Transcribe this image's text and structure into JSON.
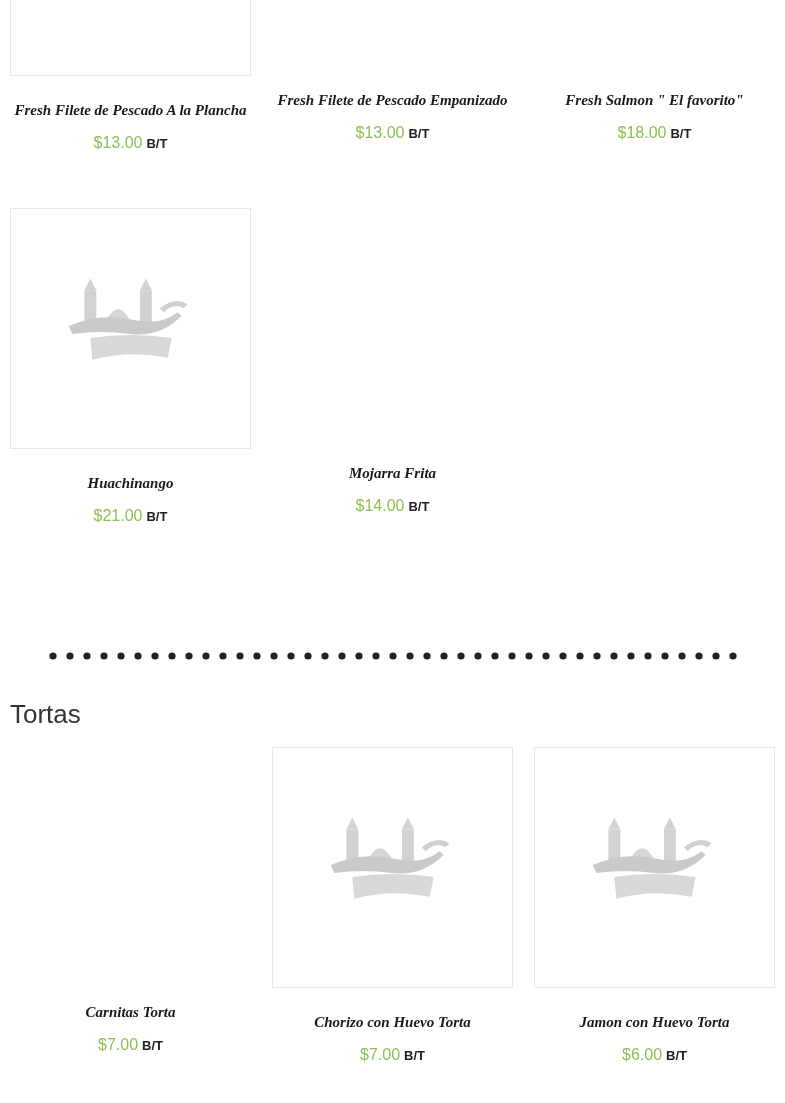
{
  "sections": [
    {
      "items": [
        {
          "name": "Fresh Filete de Pescado A la Plancha",
          "price": "$13.00",
          "unit": "B/T",
          "kind": "picture"
        },
        {
          "name": "Fresh Filete de Pescado Empanizado",
          "price": "$13.00",
          "unit": "B/T",
          "kind": "blank"
        },
        {
          "name": "Fresh Salmon \" El favorito\"",
          "price": "$18.00",
          "unit": "B/T",
          "kind": "blank"
        },
        {
          "name": "Huachinango",
          "price": "$21.00",
          "unit": "B/T",
          "kind": "picture"
        },
        {
          "name": "Mojarra Frita",
          "price": "$14.00",
          "unit": "B/T",
          "kind": "blank"
        }
      ]
    },
    {
      "heading": "Tortas",
      "items": [
        {
          "name": "Carnitas Torta",
          "price": "$7.00",
          "unit": "B/T",
          "kind": "blank"
        },
        {
          "name": "Chorizo con Huevo Torta",
          "price": "$7.00",
          "unit": "B/T",
          "kind": "picture"
        },
        {
          "name": "Jamon con Huevo Torta",
          "price": "$6.00",
          "unit": "B/T",
          "kind": "picture"
        }
      ]
    }
  ]
}
